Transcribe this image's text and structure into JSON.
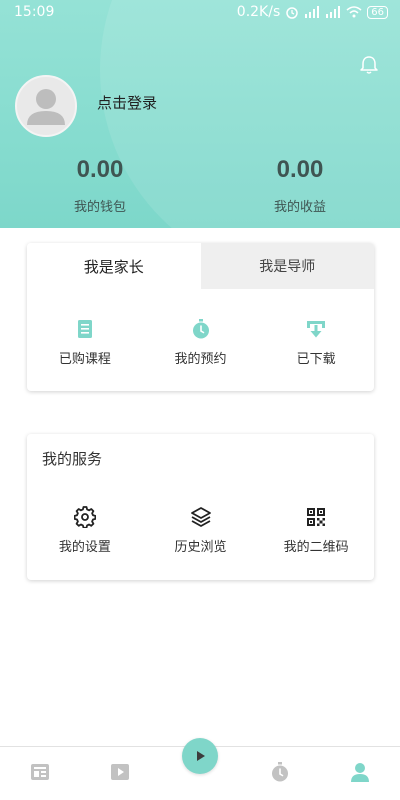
{
  "status_bar": {
    "time": "15:09",
    "speed": "0.2K/s",
    "battery": "66"
  },
  "profile": {
    "login_label": "点击登录"
  },
  "stats": [
    {
      "value": "0.00",
      "label": "我的钱包"
    },
    {
      "value": "0.00",
      "label": "我的收益"
    }
  ],
  "role_tabs": [
    {
      "label": "我是家长",
      "active": true
    },
    {
      "label": "我是导师",
      "active": false
    }
  ],
  "parent_items": [
    {
      "label": "已购课程",
      "icon": "receipt-icon"
    },
    {
      "label": "我的预约",
      "icon": "stopwatch-icon"
    },
    {
      "label": "已下载",
      "icon": "download-icon"
    }
  ],
  "services": {
    "title": "我的服务",
    "items": [
      {
        "label": "我的设置",
        "icon": "gear-icon"
      },
      {
        "label": "历史浏览",
        "icon": "layers-icon"
      },
      {
        "label": "我的二维码",
        "icon": "qr-code-icon"
      }
    ]
  },
  "tab_bar": [
    {
      "name": "news-icon",
      "active": false
    },
    {
      "name": "video-icon",
      "active": false
    },
    {
      "name": "play-icon",
      "active": false
    },
    {
      "name": "stopwatch-icon",
      "active": false
    },
    {
      "name": "user-icon",
      "active": true
    }
  ],
  "colors": {
    "accent": "#7fd6c9",
    "header": "#8bded1",
    "tab_inactive_bg": "#efefef",
    "icon_gray": "#c2c2c2"
  }
}
